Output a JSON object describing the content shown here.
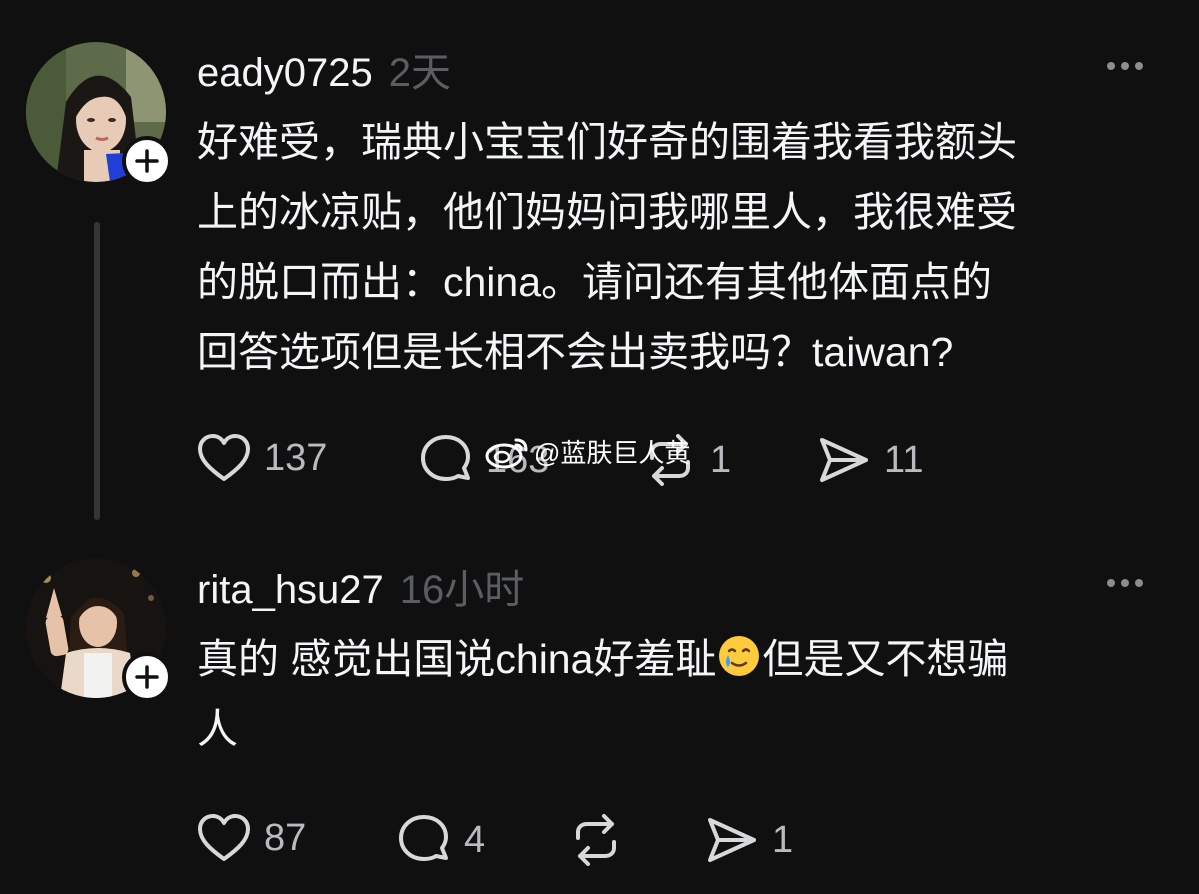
{
  "posts": [
    {
      "username": "eady0725",
      "time": "2天",
      "text": "好难受，瑞典小宝宝们好奇的围着我看我额头\n上的冰凉贴，他们妈妈问我哪里人，我很难受\n的脱口而出：china。请问还有其他体面点的\n回答选项但是长相不会出卖我吗？taiwan?",
      "likes": "137",
      "replies": "163",
      "reposts": "1",
      "shares": "11"
    },
    {
      "username": "rita_hsu27",
      "time": "16小时",
      "text_before_emoji": "真的 感觉出国说china好羞耻",
      "emoji": "smiling-face-with-tear",
      "text_after_emoji": "但是又不想骗\n人",
      "likes": "87",
      "replies": "4",
      "reposts": "",
      "shares": "1"
    }
  ],
  "watermark": "@蓝肤巨人黄",
  "icons": {
    "like": "heart-icon",
    "reply": "comment-bubble-icon",
    "repost": "repost-arrows-icon",
    "share": "send-icon",
    "more": "more-dots-icon",
    "follow": "plus-icon"
  },
  "colors": {
    "background": "#101010",
    "text": "#f3f5f7",
    "muted": "#5a5e63",
    "icon": "#d6d8da"
  }
}
